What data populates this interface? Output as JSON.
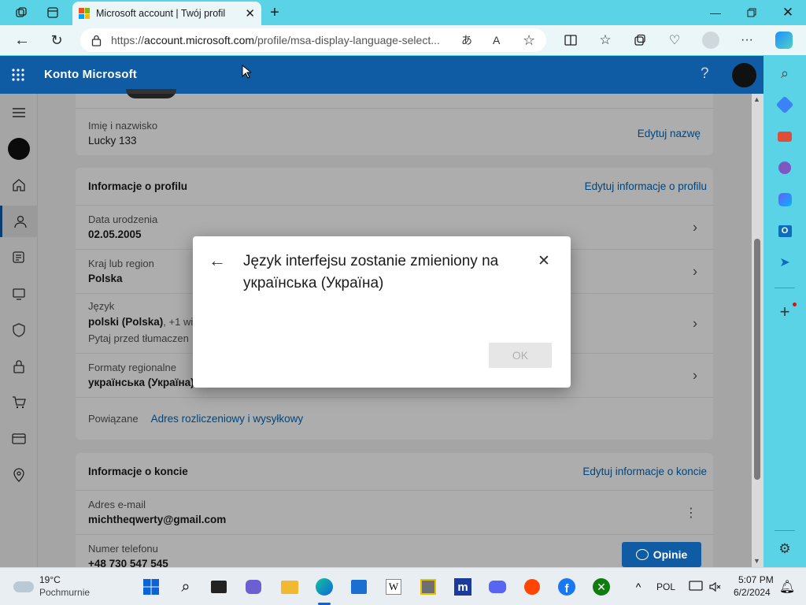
{
  "browser": {
    "tab_title": "Microsoft account | Twój profil",
    "url_prefix": "https://",
    "url_domain": "account.microsoft.com",
    "url_path": "/profile/msa-display-language-select..."
  },
  "header": {
    "title": "Konto Microsoft",
    "help": "?"
  },
  "name_card": {
    "label": "Imię i nazwisko",
    "value": "Lucky 133",
    "edit": "Edytuj nazwę"
  },
  "profile_card": {
    "heading": "Informacje o profilu",
    "edit": "Edytuj informacje o profilu",
    "birth_label": "Data urodzenia",
    "birth_value": "02.05.2005",
    "region_label": "Kraj lub region",
    "region_value": "Polska",
    "lang_label": "Język",
    "lang_value": "polski (Polska)",
    "lang_more": ", +1 wi",
    "lang_note": "Pytaj przed tłumaczen",
    "formats_label": "Formaty regionalne",
    "formats_value": "українська (Україна)",
    "related_label": "Powiązane",
    "related_link": "Adres rozliczeniowy i wysyłkowy"
  },
  "account_card": {
    "heading": "Informacje o koncie",
    "edit": "Edytuj informacje o koncie",
    "email_label": "Adres e-mail",
    "email_value": "michtheqwerty@gmail.com",
    "phone_label": "Numer telefonu",
    "phone_value": "+48 730 547 545"
  },
  "feedback_button": "Opinie",
  "dialog": {
    "title": "Język interfejsu zostanie zmieniony na українська (Україна)",
    "ok": "OK"
  },
  "taskbar": {
    "temp": "19°C",
    "weather": "Pochmurnie",
    "lang": "POL",
    "time": "5:07 PM",
    "date": "6/2/2024"
  },
  "colors": {
    "header": "#0f5ba4",
    "accent": "#5ad3e6",
    "link": "#0067b8"
  }
}
